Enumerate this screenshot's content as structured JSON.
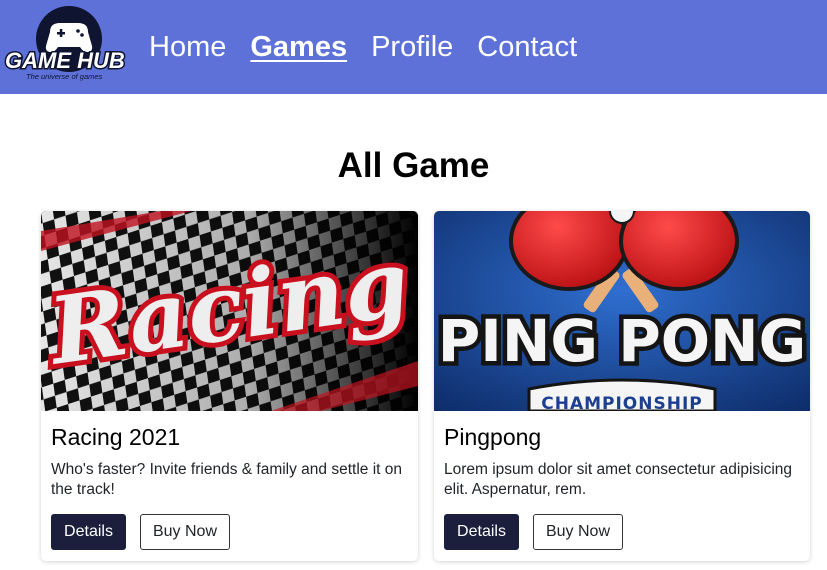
{
  "brand": {
    "name": "GAME HUB",
    "tagline": "The universe of games"
  },
  "nav": {
    "items": [
      {
        "label": "Home"
      },
      {
        "label": "Games"
      },
      {
        "label": "Profile"
      },
      {
        "label": "Contact"
      }
    ],
    "active": "Games"
  },
  "main": {
    "title": "All Game",
    "cards": [
      {
        "image_text": "Racing",
        "title": "Racing 2021",
        "text": "Who's faster? Invite friends & family and settle it on the track!",
        "details_label": "Details",
        "buy_label": "Buy Now"
      },
      {
        "image_text": "PING PONG",
        "image_subtext": "CHAMPIONSHIP",
        "title": "Pingpong",
        "text": "Lorem ipsum dolor sit amet consectetur adipisicing elit. Aspernatur, rem.",
        "details_label": "Details",
        "buy_label": "Buy Now"
      }
    ]
  },
  "colors": {
    "navbar": "#5e71d8",
    "button_dark": "#1b1f3b"
  }
}
